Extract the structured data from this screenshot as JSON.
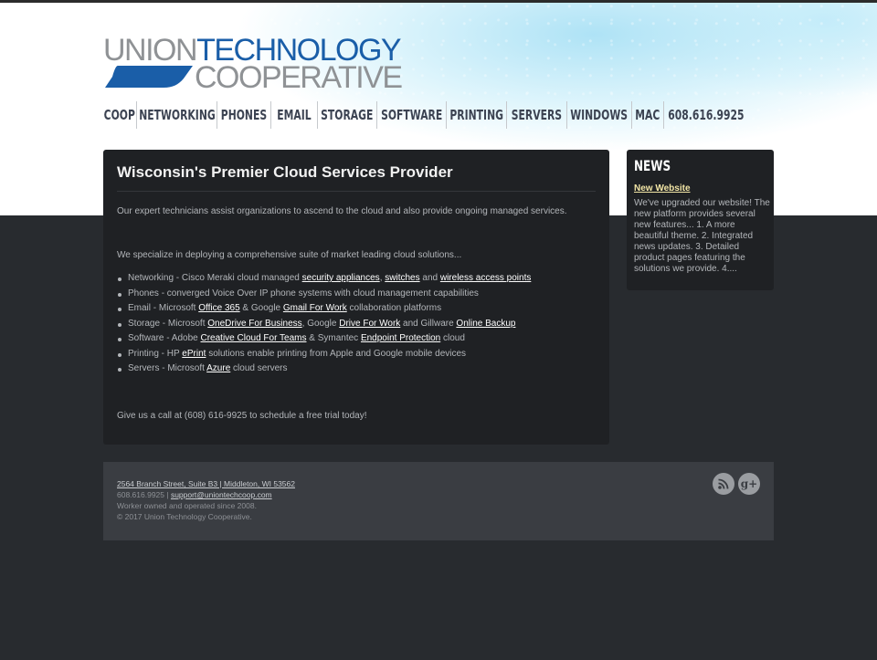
{
  "logo": {
    "line1_gray": "UNION",
    "line1_blue": "TECHNOLOGY",
    "line2": "COOPERATIVE"
  },
  "nav": [
    {
      "label": "COOP"
    },
    {
      "label": "NETWORKING"
    },
    {
      "label": "PHONES"
    },
    {
      "label": "EMAIL"
    },
    {
      "label": "STORAGE"
    },
    {
      "label": "SOFTWARE"
    },
    {
      "label": "PRINTING"
    },
    {
      "label": "SERVERS"
    },
    {
      "label": "WINDOWS"
    },
    {
      "label": "MAC"
    },
    {
      "label": "608.616.9925"
    }
  ],
  "main": {
    "title": "Wisconsin's Premier Cloud Services Provider",
    "intro": "Our expert technicians assist organizations to ascend to the cloud and also provide ongoing managed services.",
    "specialize": "We specialize in deploying a comprehensive suite of market leading cloud solutions...",
    "services": {
      "networking": {
        "prefix": "Networking - Cisco Meraki cloud managed ",
        "link1": "security appliances",
        "sep1": ", ",
        "link2": "switches",
        "sep2": " and ",
        "link3": "wireless access points"
      },
      "phones": {
        "text": "Phones - converged Voice Over IP phone systems with cloud management capabilities"
      },
      "email": {
        "prefix": "Email - Microsoft ",
        "link1": "Office 365",
        "sep1": " & Google ",
        "link2": "Gmail For Work",
        "suffix": " collaboration platforms"
      },
      "storage": {
        "prefix": "Storage - Microsoft ",
        "link1": "OneDrive For Business",
        "sep1": ", Google ",
        "link2": "Drive For Work",
        "sep2": " and Gillware ",
        "link3": "Online Backup"
      },
      "software": {
        "prefix": "Software - Adobe ",
        "link1": "Creative Cloud For Teams",
        "sep1": " & Symantec ",
        "link2": "Endpoint Protection",
        "suffix": " cloud"
      },
      "printing": {
        "prefix": "Printing - HP ",
        "link1": "ePrint",
        "suffix": " solutions enable printing from Apple and Google mobile devices"
      },
      "servers": {
        "prefix": "Servers - Microsoft ",
        "link1": "Azure",
        "suffix": " cloud servers"
      }
    },
    "call": "Give us a call at (608) 616-9925 to schedule a free trial today!"
  },
  "news": {
    "heading": "NEWS",
    "link": "New Website",
    "body": "We've upgraded our website! The new platform provides several new features... 1. A more beautiful theme. 2. Integrated news updates. 3. Detailed product pages featuring the solutions we provide. 4...."
  },
  "footer": {
    "address": "2564 Branch Street, Suite B3 | Middleton, WI 53562",
    "phone": "608.616.9925 | ",
    "email": "support@uniontechcoop.com",
    "owned": "Worker owned and operated since 2008.",
    "copyright": "© 2017 Union Technology Cooperative."
  },
  "colors": {
    "brand_blue": "#1a5ea8",
    "logo_gray": "#8f9295",
    "nav_text": "#3c4352",
    "panel_bg": "#1f2124",
    "page_bg": "#282b2f",
    "news_link": "#f3e6a6"
  },
  "icons": [
    "rss-icon",
    "google-plus-icon"
  ]
}
